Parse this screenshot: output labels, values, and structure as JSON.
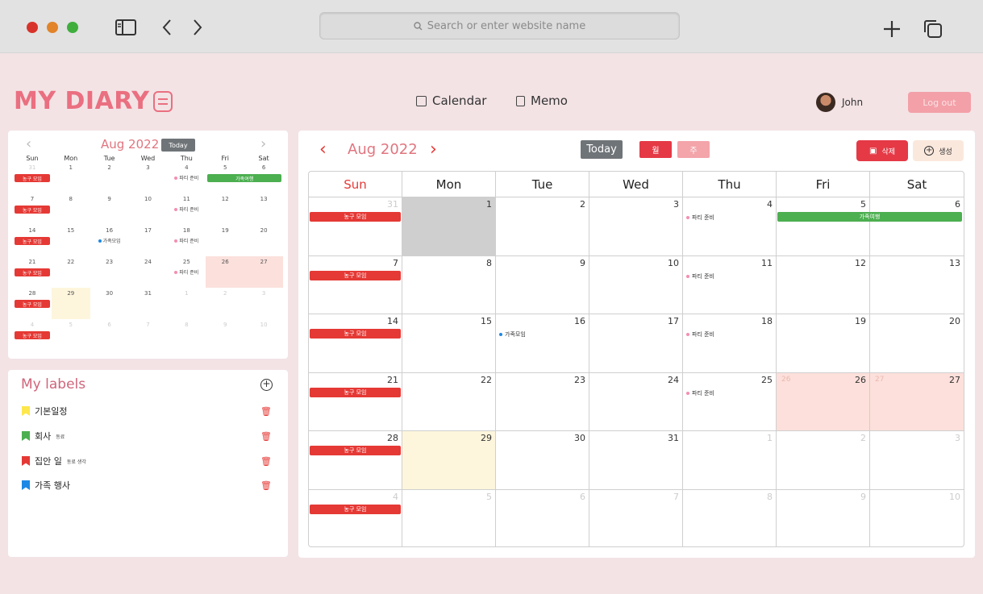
{
  "browser": {
    "search_placeholder": "Search or enter website name"
  },
  "header": {
    "logo": "MY DIARY",
    "nav": {
      "calendar": "Calendar",
      "memo": "Memo"
    },
    "user_name": "John",
    "logout": "Log out"
  },
  "colors": {
    "accent": "#e53946",
    "pink": "#ea6f80",
    "basketball": "#e53935",
    "family": "#4caf50",
    "work_dot": "#f48fb1",
    "family_dot": "#1e88e5"
  },
  "mini": {
    "month": "Aug 2022",
    "today": "Today",
    "dow": [
      "Sun",
      "Mon",
      "Tue",
      "Wed",
      "Thu",
      "Fri",
      "Sat"
    ],
    "weeks": [
      [
        "31",
        "1",
        "2",
        "3",
        "4",
        "5",
        "6"
      ],
      [
        "7",
        "8",
        "9",
        "10",
        "11",
        "12",
        "13"
      ],
      [
        "14",
        "15",
        "16",
        "17",
        "18",
        "19",
        "20"
      ],
      [
        "21",
        "22",
        "23",
        "24",
        "25",
        "26",
        "27"
      ],
      [
        "28",
        "29",
        "30",
        "31",
        "1",
        "2",
        "3"
      ],
      [
        "4",
        "5",
        "6",
        "7",
        "8",
        "9",
        "10"
      ]
    ],
    "events": {
      "basketball": "농구 모임",
      "party": "파티 준비",
      "family_trip": "가족여행",
      "family_meet": "가족모임"
    }
  },
  "labels": {
    "title": "My labels",
    "items": [
      {
        "name": "기본일정",
        "sub": "",
        "color": "#fde74c"
      },
      {
        "name": "회사",
        "sub": "동료",
        "color": "#4caf50"
      },
      {
        "name": "집안 일",
        "sub": "동료 생각",
        "color": "#e53935"
      },
      {
        "name": "가족 행사",
        "sub": "",
        "color": "#1e88e5"
      }
    ]
  },
  "main": {
    "month": "Aug 2022",
    "today": "Today",
    "view_month": "월",
    "view_week": "주",
    "delete": "삭제",
    "create": "생성",
    "dow": [
      "Sun",
      "Mon",
      "Tue",
      "Wed",
      "Thu",
      "Fri",
      "Sat"
    ],
    "weeks": [
      [
        "31",
        "1",
        "2",
        "3",
        "4",
        "5",
        "6"
      ],
      [
        "7",
        "8",
        "9",
        "10",
        "11",
        "12",
        "13"
      ],
      [
        "14",
        "15",
        "16",
        "17",
        "18",
        "19",
        "20"
      ],
      [
        "21",
        "22",
        "23",
        "24",
        "25",
        "26",
        "27"
      ],
      [
        "28",
        "29",
        "30",
        "31",
        "1",
        "2",
        "3"
      ],
      [
        "4",
        "5",
        "6",
        "7",
        "8",
        "9",
        "10"
      ]
    ],
    "faint": {
      "fri": "26",
      "sat": "27"
    },
    "events": {
      "basketball": "농구 모임",
      "party": "파티 준비",
      "family_trip": "가족여행",
      "family_meet": "가족모임"
    }
  }
}
